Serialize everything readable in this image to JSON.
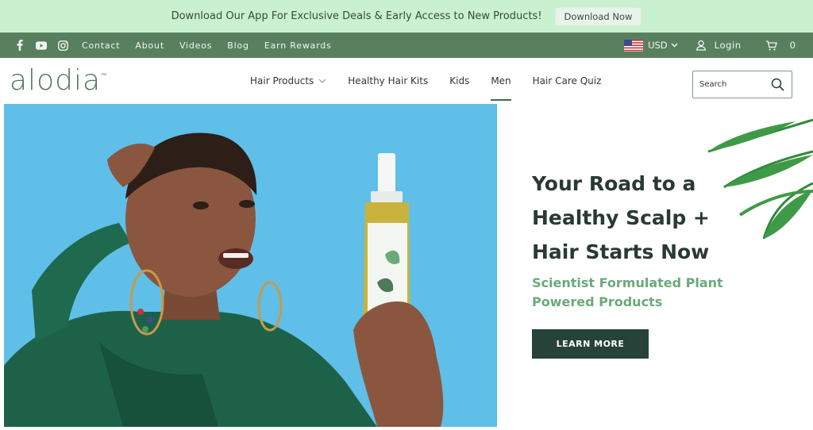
{
  "promo": {
    "text": "Download Our App For Exclusive Deals & Early Access to New Products!",
    "button": "Download Now"
  },
  "utility": {
    "social_icons": [
      "facebook-icon",
      "youtube-icon",
      "instagram-icon"
    ],
    "links": [
      "Contact",
      "About",
      "Videos",
      "Blog",
      "Earn Rewards"
    ],
    "currency": "USD",
    "login": "Login",
    "cart_count": "0"
  },
  "header": {
    "logo": "alodia",
    "nav": [
      {
        "label": "Hair Products",
        "has_dropdown": true
      },
      {
        "label": "Healthy Hair Kits"
      },
      {
        "label": "Kids"
      },
      {
        "label": "Men",
        "active": true
      },
      {
        "label": "Hair Care Quiz"
      }
    ],
    "search_placeholder": "Search"
  },
  "hero": {
    "headline_lines": [
      "Your Road to a",
      "Healthy Scalp +",
      "Hair Starts Now"
    ],
    "subhead_lines": [
      "Scientist Formulated Plant",
      "Powered Products"
    ],
    "cta": "LEARN MORE"
  },
  "colors": {
    "promo_bg": "#c9f0cf",
    "utility_bg": "#58805f",
    "brand_green": "#4f7a5a",
    "subhead_green": "#6aaa7a",
    "cta_bg": "#264239",
    "hero_sky": "#5fbfe8"
  }
}
